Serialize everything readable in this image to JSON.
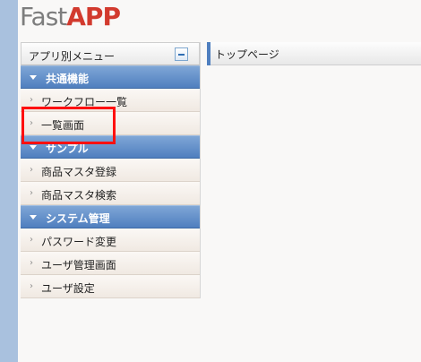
{
  "header": {
    "logo_part1": "Fast",
    "logo_part2": "APP"
  },
  "sidebar": {
    "title": "アプリ別メニュー",
    "collapse_icon": "minus-icon",
    "groups": [
      {
        "label": "共通機能",
        "items": [
          {
            "label": "ワークフロー一覧"
          },
          {
            "label": "一覧画面"
          }
        ]
      },
      {
        "label": "サンプル",
        "items": [
          {
            "label": "商品マスタ登録"
          },
          {
            "label": "商品マスタ検索"
          }
        ]
      },
      {
        "label": "システム管理",
        "items": [
          {
            "label": "パスワード変更"
          },
          {
            "label": "ユーザ管理画面"
          },
          {
            "label": "ユーザ設定"
          }
        ]
      }
    ]
  },
  "main": {
    "title": "トップページ"
  },
  "colors": {
    "logo_gray": "#7d7d7d",
    "logo_red": "#d23a2e",
    "group_blue": "#5b8ac7",
    "highlight_red": "#ff1010"
  }
}
